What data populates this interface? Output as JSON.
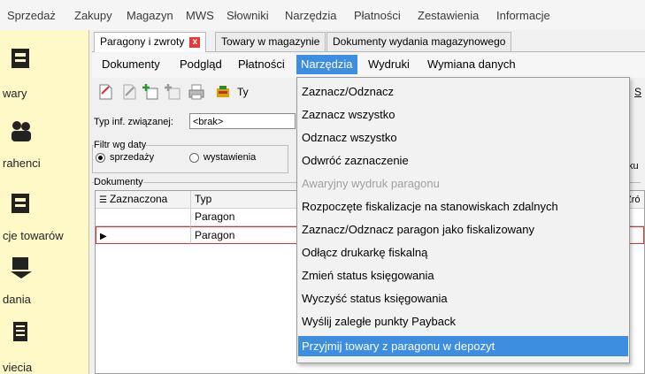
{
  "top_menu": [
    "Sprzedaż",
    "Zakupy",
    "Magazyn",
    "MWS",
    "Słowniki",
    "Narzędzia",
    "Płatności",
    "Zestawienia",
    "Informacje"
  ],
  "sidebar": {
    "items": [
      {
        "label": "wary",
        "icon": "goods-icon"
      },
      {
        "label": "rahenci",
        "icon": "contractors-icon"
      },
      {
        "label": "cje towarów",
        "icon": "goods-operations-icon"
      },
      {
        "label": "dania",
        "icon": "issue-icon"
      },
      {
        "label": "viecia",
        "icon": "receipt-icon"
      }
    ]
  },
  "tabs": [
    {
      "label": "Paragony i zwroty",
      "active": true,
      "close": "x"
    },
    {
      "label": "Towary w magazynie",
      "active": false
    },
    {
      "label": "Dokumenty wydania magazynowego",
      "active": false
    }
  ],
  "inner_menu": [
    "Dokumenty",
    "Podgląd",
    "Płatności",
    "Narzędzia",
    "Wydruki",
    "Wymiana danych"
  ],
  "toolbar": {
    "partial_label": "Ty",
    "right_partial": "S"
  },
  "filters": {
    "related_info_label": "Typ inf. związanej:",
    "related_info_value": "<brak>",
    "date_group_label": "Filtr wg daty",
    "radio_sale": "sprzedaży",
    "radio_issue": "wystawienia",
    "right_partial": "ku"
  },
  "documents_group_label": "Dokumenty",
  "grid": {
    "columns": [
      "Zaznaczona",
      "Typ"
    ],
    "right_partial_header": "Źró",
    "rows": [
      {
        "zaznaczona": "",
        "typ": "Paragon",
        "selected": false
      },
      {
        "zaznaczona": "",
        "typ": "Paragon",
        "selected": true
      }
    ]
  },
  "dropdown": {
    "items": [
      {
        "label": "Zaznacz/Odznacz",
        "disabled": false,
        "hover": false
      },
      {
        "label": "Zaznacz wszystko",
        "disabled": false,
        "hover": false
      },
      {
        "label": "Odznacz wszystko",
        "disabled": false,
        "hover": false
      },
      {
        "label": "Odwróć zaznaczenie",
        "disabled": false,
        "hover": false
      },
      {
        "label": "Awaryjny wydruk paragonu",
        "disabled": true,
        "hover": false
      },
      {
        "label": "Rozpoczęte fiskalizacje na stanowiskach zdalnych",
        "disabled": false,
        "hover": false
      },
      {
        "label": "Zaznacz/Odznacz paragon jako fiskalizowany",
        "disabled": false,
        "hover": false
      },
      {
        "label": "Odłącz drukarkę fiskalną",
        "disabled": false,
        "hover": false
      },
      {
        "label": "Zmień status księgowania",
        "disabled": false,
        "hover": false
      },
      {
        "label": "Wyczyść status księgowania",
        "disabled": false,
        "hover": false
      },
      {
        "label": "Wyślij zaległe punkty Payback",
        "disabled": false,
        "hover": false
      },
      {
        "label": "Przyjmij towary z paragonu w depozyt",
        "disabled": false,
        "hover": true
      }
    ]
  },
  "colors": {
    "highlight": "#3d8de0",
    "sidebar_bg": "#fff9c8",
    "tab_close": "#e23b3b",
    "row_selected_border": "#e03030"
  }
}
